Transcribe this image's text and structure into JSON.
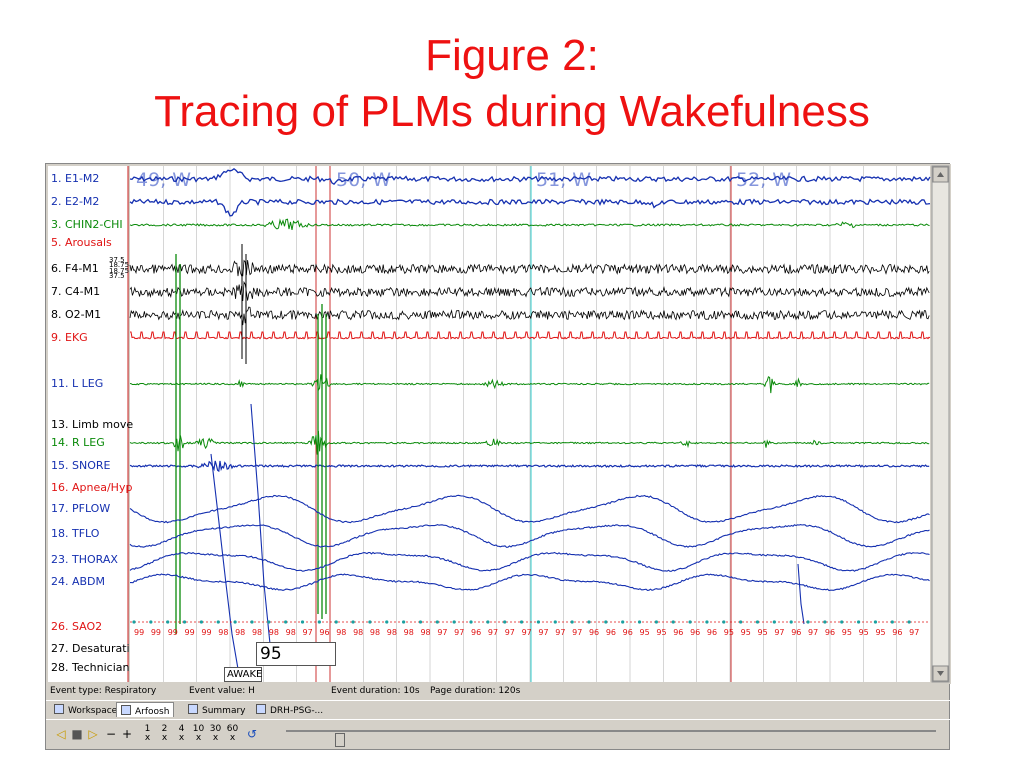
{
  "slide": {
    "title_line1": "Figure 2:",
    "title_line2": "Tracing of PLMs during Wakefulness"
  },
  "epochs": [
    "49, W",
    "50, W",
    "51, W",
    "52, W"
  ],
  "channels": [
    {
      "label": "1. E1-M2",
      "color": "#1530b0"
    },
    {
      "label": "2. E2-M2",
      "color": "#1530b0"
    },
    {
      "label": "3. CHIN2-CHI",
      "color": "#0a8a0a"
    },
    {
      "label": "5. Arousals",
      "color": "#e01414"
    },
    {
      "label": "6. F4-M1",
      "color": "#000000"
    },
    {
      "label": "7. C4-M1",
      "color": "#000000"
    },
    {
      "label": "8. O2-M1",
      "color": "#000000"
    },
    {
      "label": "9. EKG",
      "color": "#e01414"
    },
    {
      "label": "11. L LEG",
      "color": "#1530b0"
    },
    {
      "label": "13. Limb move",
      "color": "#000000"
    },
    {
      "label": "14. R LEG",
      "color": "#0a8a0a"
    },
    {
      "label": "15. SNORE",
      "color": "#1530b0"
    },
    {
      "label": "16. Apnea/Hyp",
      "color": "#e01414"
    },
    {
      "label": "17. PFLOW",
      "color": "#1530b0"
    },
    {
      "label": "18. TFLO",
      "color": "#1530b0"
    },
    {
      "label": "23. THORAX",
      "color": "#1530b0"
    },
    {
      "label": "24. ABDM",
      "color": "#1530b0"
    },
    {
      "label": "26. SAO2",
      "color": "#e01414"
    },
    {
      "label": "27. Desaturati",
      "color": "#000000"
    },
    {
      "label": "28. Technician",
      "color": "#000000"
    }
  ],
  "scale_marks": [
    "37.5",
    "18.75",
    "18.75",
    "37.5"
  ],
  "sao2_values": [
    99,
    99,
    99,
    99,
    99,
    98,
    98,
    98,
    98,
    98,
    97,
    96,
    98,
    98,
    98,
    98,
    98,
    98,
    97,
    97,
    96,
    97,
    97,
    97,
    97,
    97,
    97,
    96,
    96,
    96,
    95,
    95,
    96,
    96,
    96,
    95,
    95,
    95,
    97,
    96,
    97,
    96,
    95,
    95,
    95,
    96,
    97
  ],
  "spo2_readout": "95",
  "technician_event": "AWAKE",
  "status_bar": {
    "event_type": "Event type: Respiratory",
    "event_value": "Event value: H",
    "event_duration": "Event duration: 10s",
    "page_duration": "Page duration: 120s"
  },
  "tabs": [
    "Workspace",
    "Arfoosh",
    "Summary",
    "DRH-PSG-..."
  ],
  "toolbar": {
    "prev": "◁",
    "stop": "■",
    "play": "▷",
    "minus": "−",
    "plus": "+",
    "fracs": [
      {
        "top": "1",
        "bottom": "x"
      },
      {
        "top": "2",
        "bottom": "x"
      },
      {
        "top": "4",
        "bottom": "x"
      },
      {
        "top": "10",
        "bottom": "x"
      },
      {
        "top": "30",
        "bottom": "x"
      },
      {
        "top": "60",
        "bottom": "x"
      }
    ],
    "refresh": "↺"
  },
  "slider": {
    "position": 0.075
  },
  "colors": {
    "title": "#ee1111",
    "blue": "#1530b0",
    "green": "#0a8a0a",
    "red": "#e01414",
    "cyan": "#33cccc"
  }
}
